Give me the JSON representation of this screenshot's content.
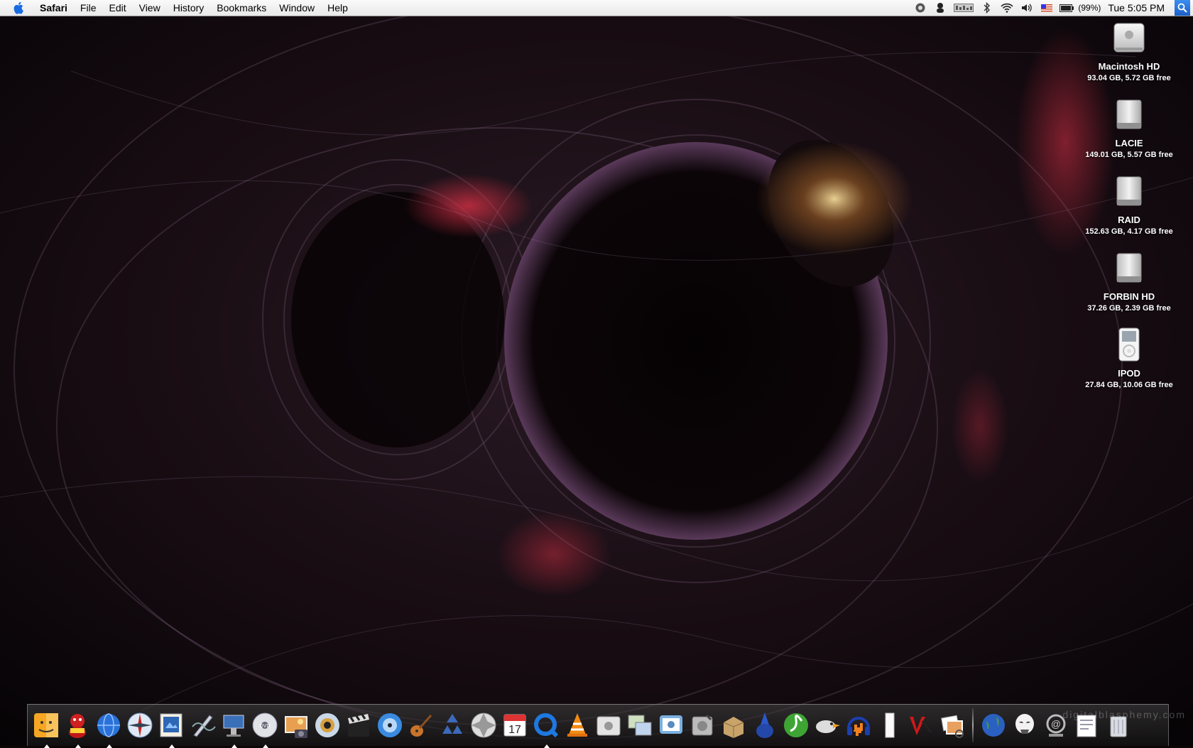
{
  "menubar": {
    "app_name": "Safari",
    "items": [
      "File",
      "Edit",
      "View",
      "History",
      "Bookmarks",
      "Window",
      "Help"
    ],
    "status": {
      "battery_percent": "(99%)",
      "clock": "Tue 5:05 PM"
    }
  },
  "desktop": {
    "drives": [
      {
        "name": "Macintosh HD",
        "info": "93.04 GB, 5.72 GB free",
        "icon": "apple-hd-icon"
      },
      {
        "name": "LACIE",
        "info": "149.01 GB, 5.57 GB free",
        "icon": "hard-drive-icon"
      },
      {
        "name": "RAID",
        "info": "152.63 GB, 4.17 GB free",
        "icon": "hard-drive-icon"
      },
      {
        "name": "FORBIN HD",
        "info": "37.26 GB, 2.39 GB free",
        "icon": "hard-drive-icon"
      },
      {
        "name": "IPOD",
        "info": "27.84 GB, 10.06 GB free",
        "icon": "ipod-icon"
      }
    ]
  },
  "dock": {
    "apps": [
      {
        "icon": "finder-icon",
        "running": true
      },
      {
        "icon": "adium-icon",
        "running": true
      },
      {
        "icon": "network-globe-icon",
        "running": true
      },
      {
        "icon": "safari-compass-icon",
        "running": false
      },
      {
        "icon": "mail-stamp-icon",
        "running": true
      },
      {
        "icon": "script-editor-icon",
        "running": false
      },
      {
        "icon": "keynote-podium-icon",
        "running": true
      },
      {
        "icon": "dvd-player-icon",
        "running": true
      },
      {
        "icon": "iphoto-icon",
        "running": false
      },
      {
        "icon": "itunes-eye-icon",
        "running": false
      },
      {
        "icon": "imovie-clapper-icon",
        "running": false
      },
      {
        "icon": "idvd-icon",
        "running": false
      },
      {
        "icon": "garageband-guitar-icon",
        "running": false
      },
      {
        "icon": "recycle-icon",
        "running": false
      },
      {
        "icon": "aperture-icon",
        "running": false
      },
      {
        "icon": "ical-icon",
        "running": false
      },
      {
        "icon": "quicktime-icon",
        "running": true
      },
      {
        "icon": "vlc-cone-icon",
        "running": false
      },
      {
        "icon": "system-profiler-icon",
        "running": false
      },
      {
        "icon": "remote-desktop-icon",
        "running": false
      },
      {
        "icon": "photo-booth-icon",
        "running": false
      },
      {
        "icon": "disk-utility-icon",
        "running": false
      },
      {
        "icon": "installer-box-icon",
        "running": false
      },
      {
        "icon": "wizard-icon",
        "running": false
      },
      {
        "icon": "dreamweaver-icon",
        "running": false
      },
      {
        "icon": "cyberduck-icon",
        "running": false
      },
      {
        "icon": "audacity-icon",
        "running": false
      },
      {
        "icon": "blank-document-icon",
        "running": false
      },
      {
        "icon": "vectorworks-icon",
        "running": false
      },
      {
        "icon": "preview-photos-icon",
        "running": false
      }
    ],
    "right": [
      {
        "icon": "internet-globe-icon"
      },
      {
        "icon": "stormtrooper-folder-icon"
      },
      {
        "icon": "mail-download-icon"
      },
      {
        "icon": "documents-stack-icon"
      },
      {
        "icon": "trash-icon"
      }
    ],
    "watermark": "digitalblasphemy.com"
  }
}
